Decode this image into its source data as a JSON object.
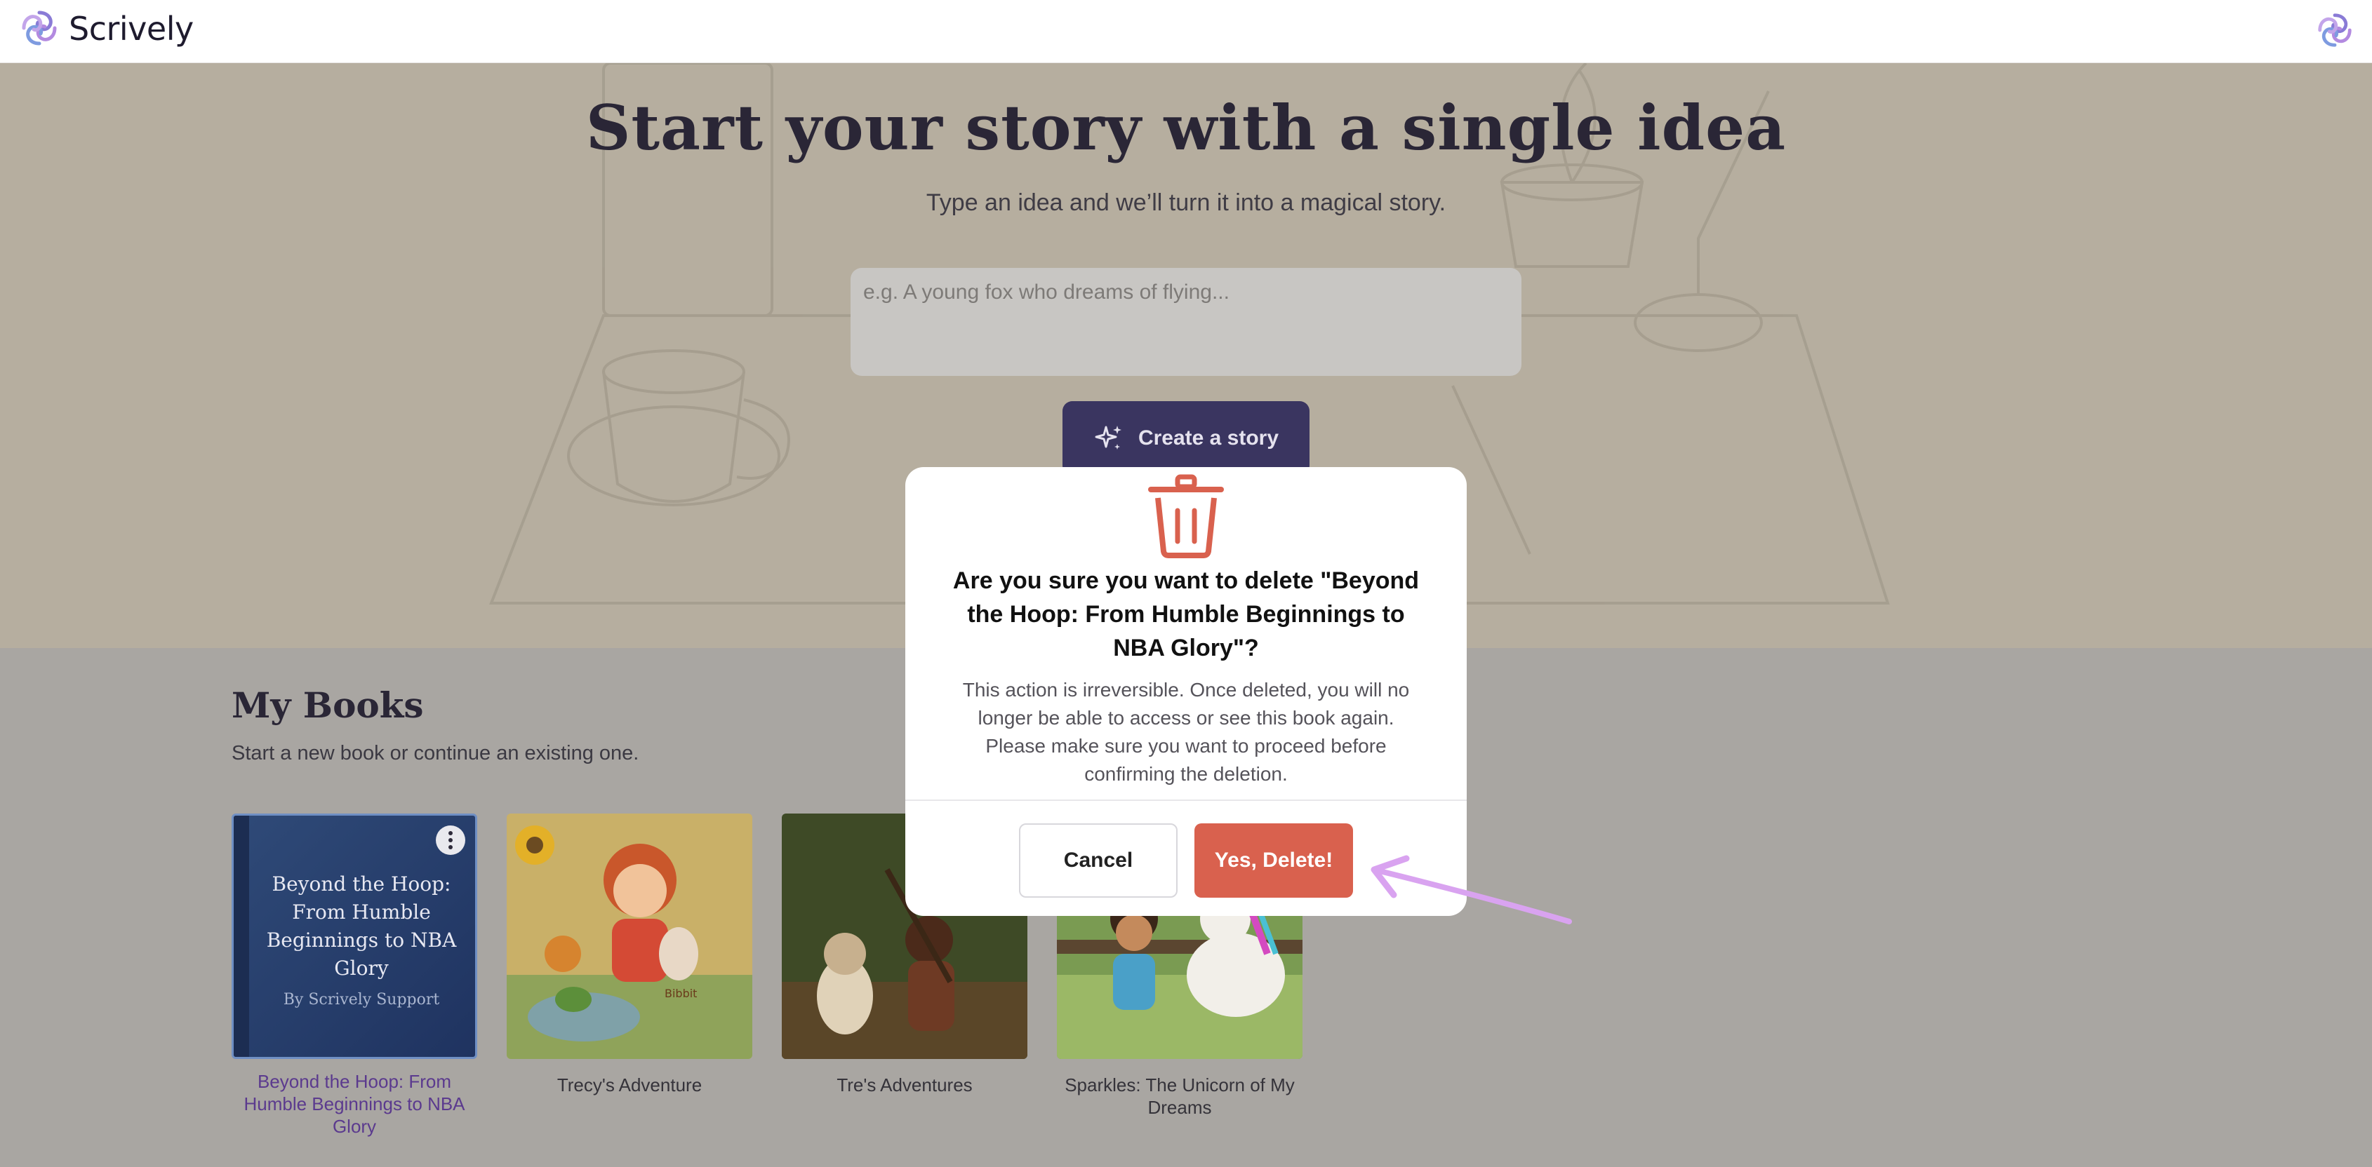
{
  "header": {
    "app_name": "Scrively",
    "logo_icon": "swirl-logo-icon",
    "avatar_icon": "swirl-avatar-icon"
  },
  "hero": {
    "title": "Start your story with a single idea",
    "subtitle": "Type an idea and we’ll turn it into a magical story.",
    "idea_placeholder": "e.g. A young fox who dreams of flying...",
    "create_button_label": "Create a story",
    "create_button_icon": "sparkles-icon"
  },
  "books": {
    "title": "My Books",
    "subtitle": "Start a new book or continue an existing one.",
    "items": [
      {
        "label": "Beyond the Hoop: From Humble Beginnings to NBA Glory",
        "cover_title": "Beyond the Hoop: From Humble Beginnings to NBA Glory",
        "cover_author": "By Scrively Support"
      },
      {
        "label": "Trecy's Adventure",
        "cover_text": "Bibbit"
      },
      {
        "label": "Tre's Adventures"
      },
      {
        "label": "Sparkles: The Unicorn of My Dreams"
      }
    ]
  },
  "modal": {
    "icon": "trash-icon",
    "title": "Are you sure you want to delete \"Beyond the Hoop: From Humble Beginnings to NBA Glory\"?",
    "body": "This action is irreversible. Once deleted, you will no longer be able to access or see this book again. Please make sure you want to proceed before confirming the deletion.",
    "cancel_label": "Cancel",
    "confirm_label": "Yes, Delete!"
  },
  "colors": {
    "accent": "#3a3560",
    "danger": "#d9614e",
    "annotation_arrow": "#d9a3f0"
  }
}
